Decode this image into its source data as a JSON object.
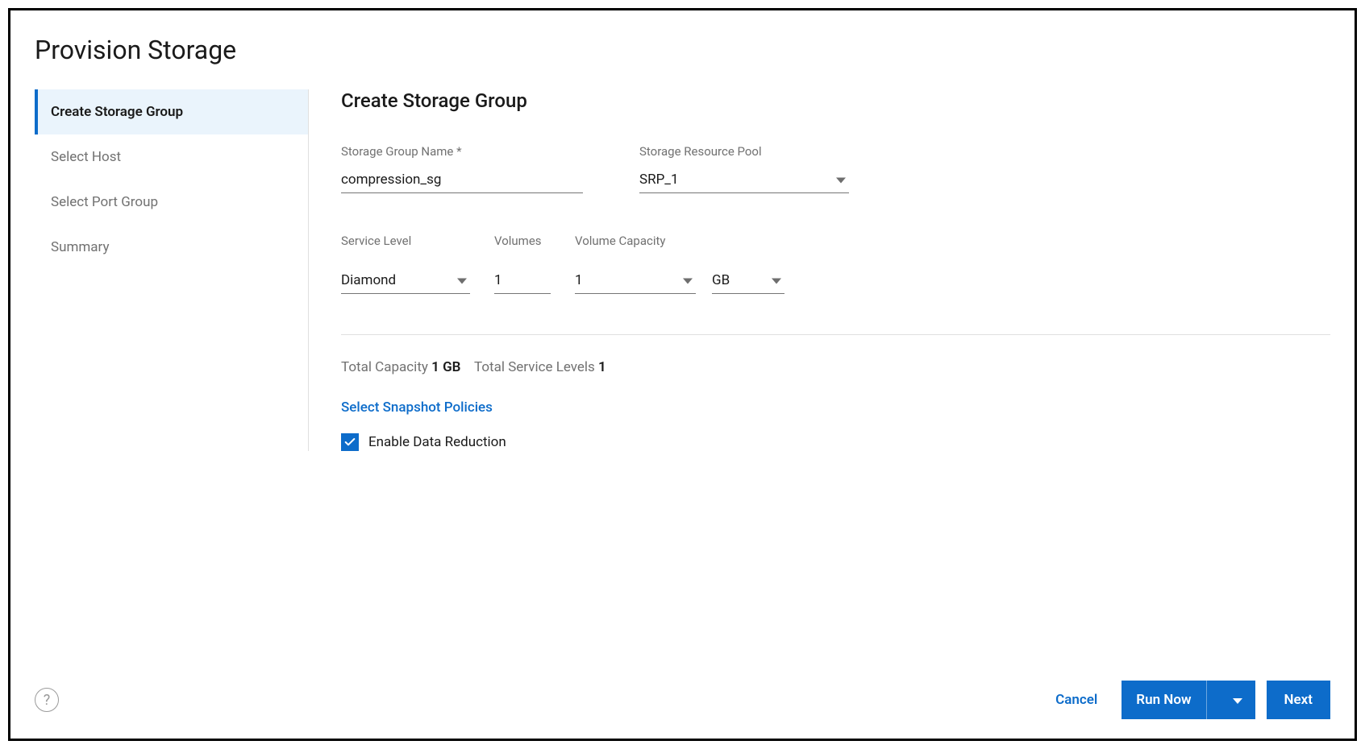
{
  "page": {
    "title": "Provision Storage"
  },
  "sidebar": {
    "items": [
      {
        "label": "Create Storage Group",
        "active": true
      },
      {
        "label": "Select Host",
        "active": false
      },
      {
        "label": "Select Port Group",
        "active": false
      },
      {
        "label": "Summary",
        "active": false
      }
    ]
  },
  "main": {
    "heading": "Create Storage Group",
    "storage_group_name_label": "Storage Group Name *",
    "storage_group_name_value": "compression_sg",
    "storage_resource_pool_label": "Storage Resource Pool",
    "storage_resource_pool_value": "SRP_1",
    "service_level_label": "Service Level",
    "service_level_value": "Diamond",
    "volumes_label": "Volumes",
    "volumes_value": "1",
    "volume_capacity_label": "Volume Capacity",
    "volume_capacity_value": "1",
    "volume_capacity_unit": "GB",
    "totals": {
      "total_capacity_label": "Total Capacity",
      "total_capacity_value": "1 GB",
      "total_service_levels_label": "Total Service Levels",
      "total_service_levels_value": "1"
    },
    "snapshot_link": "Select Snapshot Policies",
    "enable_data_reduction_label": "Enable Data Reduction",
    "enable_data_reduction_checked": true
  },
  "footer": {
    "help_glyph": "?",
    "cancel_label": "Cancel",
    "run_now_label": "Run Now",
    "next_label": "Next"
  }
}
